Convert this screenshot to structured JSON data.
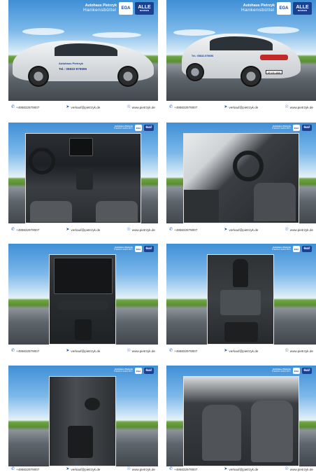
{
  "brand": {
    "dealer_line1": "Autohaus Pietrzyk",
    "dealer_line2": "Hankensbüttel",
    "ega": "EGA",
    "alle": "ALLE",
    "alle_sub": "MARKEN"
  },
  "door_text": {
    "line1": "Autohaus Pietrzyk",
    "phone": "Tel.: 05832-979696"
  },
  "plate": "GF-EE 3300",
  "footer": {
    "phone": "+495832979007",
    "email": "verkauf@pietrzyk.de",
    "web": "www.pietrzyk.de"
  },
  "icons": {
    "phone": "phone-icon",
    "email": "paper-plane-icon",
    "web": "globe-icon"
  },
  "colors": {
    "accent": "#1c3f8f",
    "icon": "#1c5aa8"
  }
}
